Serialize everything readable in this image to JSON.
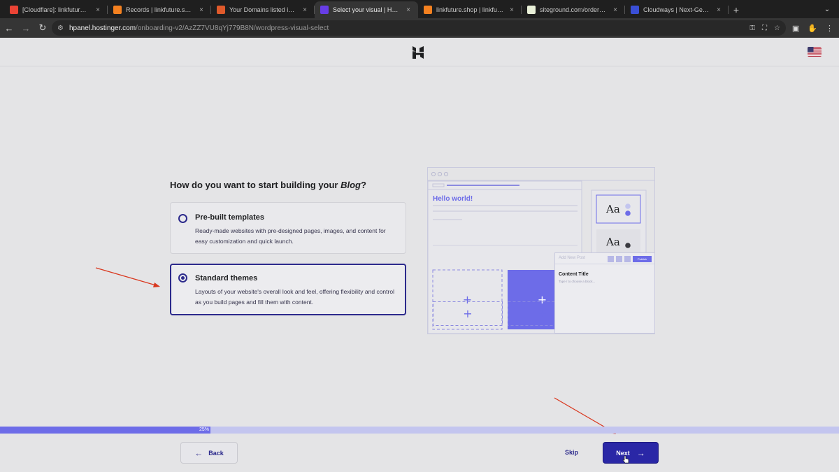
{
  "browser": {
    "tabs": [
      {
        "title": "[Cloudflare]: linkfuture.shop i",
        "icon": "gmail-icon",
        "color": "#ea4335",
        "active": false
      },
      {
        "title": "Records | linkfuture.shop | M",
        "icon": "cloudflare-icon",
        "color": "#f48120",
        "active": false
      },
      {
        "title": "Your Domains listed in one pl",
        "icon": "domain-icon",
        "color": "#e05a2b",
        "active": false
      },
      {
        "title": "Select your visual | Hostinger",
        "icon": "hostinger-icon",
        "color": "#673de6",
        "active": true
      },
      {
        "title": "linkfuture.shop | linkfuture.sh",
        "icon": "cloudflare-icon",
        "color": "#f48120",
        "active": false
      },
      {
        "title": "siteground.com/order-verific",
        "icon": "siteground-icon",
        "color": "#e9f0d8",
        "active": false
      },
      {
        "title": "Cloudways | Next-Gen Cloud",
        "icon": "cloudways-icon",
        "color": "#3a4fd6",
        "active": false
      }
    ],
    "url_host": "hpanel.hostinger.com",
    "url_path": "/onboarding-v2/AzZZ7VU8qYj779B8N/wordpress-visual-select"
  },
  "question": {
    "prefix": "How do you want to start building your ",
    "emphasis": "Blog",
    "suffix": "?"
  },
  "options": [
    {
      "title": "Pre-built templates",
      "description": "Ready-made websites with pre-designed pages, images, and content for easy customization and quick launch.",
      "selected": false
    },
    {
      "title": "Standard themes",
      "description": "Layouts of your website's overall look and feel, offering flexibility and control as you build pages and fill them with content.",
      "selected": true
    }
  ],
  "illustration": {
    "hello": "Hello world!",
    "font_sample_1": "Aa",
    "font_sample_2": "Aa",
    "editor_title": "Add New Post",
    "publish": "Publish",
    "content_title": "Content Title",
    "content_hint": "Type / to choose a block..."
  },
  "progress": {
    "value": 0.25,
    "label": "25%"
  },
  "footer": {
    "back_label": "Back",
    "skip_label": "Skip",
    "next_label": "Next"
  },
  "colors": {
    "accent": "#2c2a8c",
    "primary_button": "#2a27a6",
    "illustration_purple": "#6d6ce8",
    "annotation_arrow": "#d9371e"
  }
}
